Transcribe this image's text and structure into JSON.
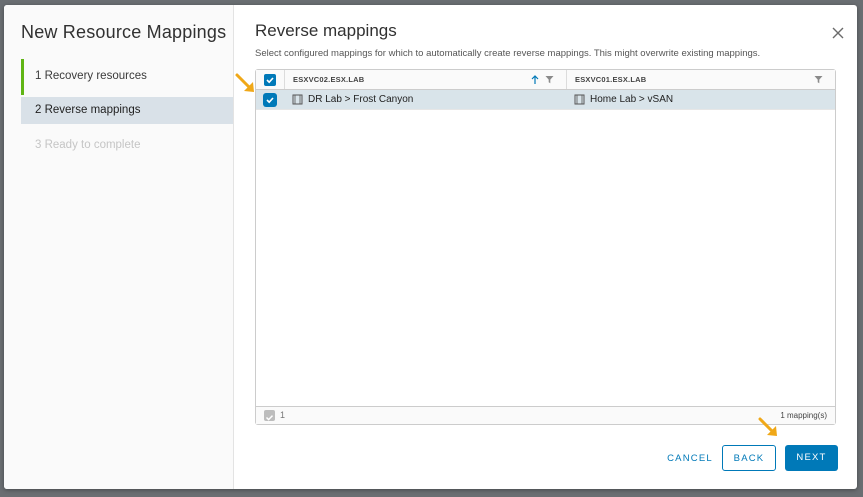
{
  "wizard": {
    "title": "New Resource Mappings",
    "steps": [
      {
        "label": "1  Recovery resources",
        "state": "done"
      },
      {
        "label": "2  Reverse mappings",
        "state": "active"
      },
      {
        "label": "3  Ready to complete",
        "state": "disabled"
      }
    ]
  },
  "page": {
    "title": "Reverse mappings",
    "description": "Select configured mappings for which to automatically create reverse mappings. This might overwrite existing mappings."
  },
  "grid": {
    "columns": [
      "ESXVC02.ESX.LAB",
      "ESXVC01.ESX.LAB"
    ],
    "rows": [
      {
        "selected": true,
        "source": "DR Lab > Frost Canyon",
        "target": "Home Lab > vSAN"
      }
    ],
    "footer": {
      "selected_count": "1",
      "total": "1 mapping(s)"
    }
  },
  "buttons": {
    "cancel": "CANCEL",
    "back": "BACK",
    "next": "NEXT"
  },
  "colors": {
    "accent": "#0079b8",
    "done_step": "#60b515",
    "selected_row": "#d9e4ea",
    "annotation_arrow": "#f0a818"
  }
}
